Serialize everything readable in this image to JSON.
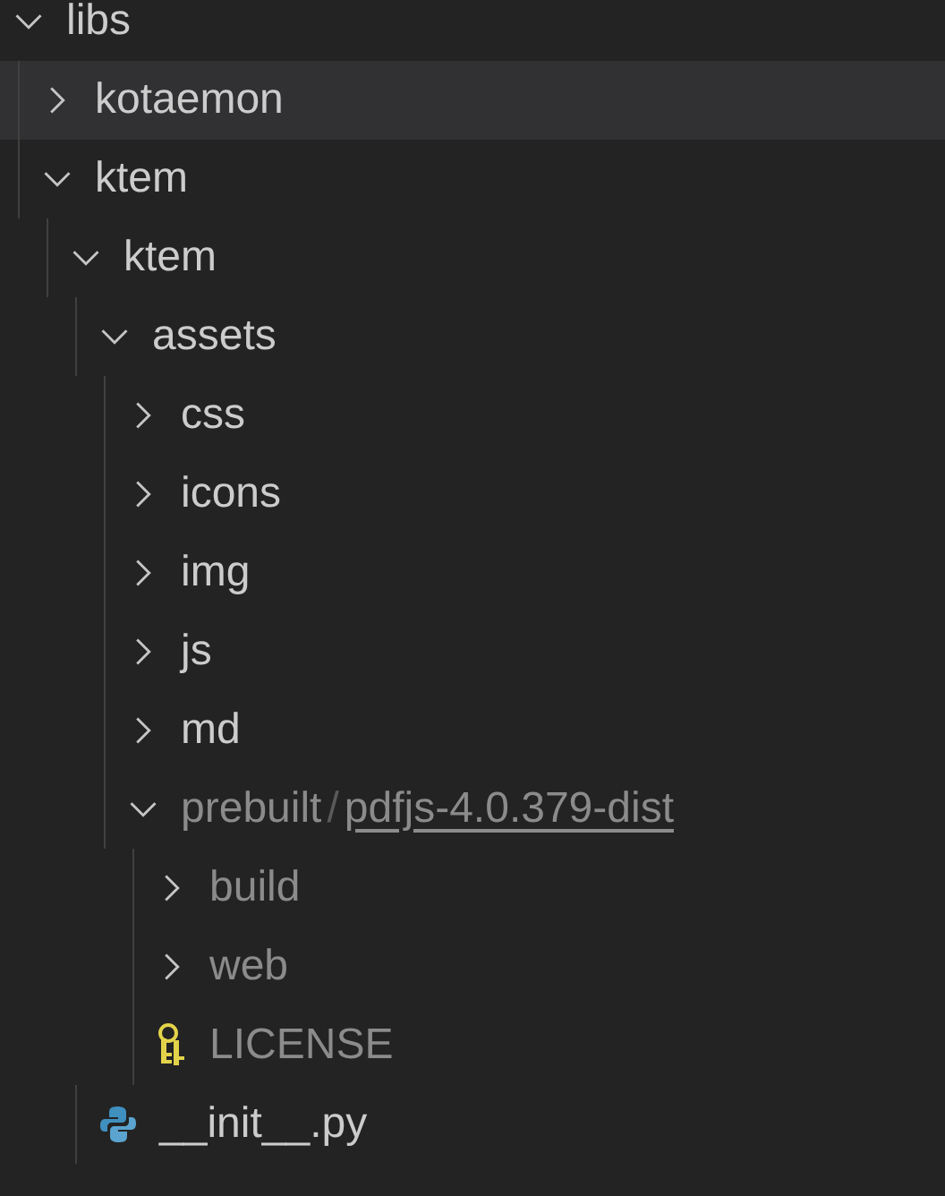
{
  "tree": [
    {
      "kind": "folder",
      "label": "libs",
      "expanded": true,
      "hovered": false,
      "ignored": false,
      "children": [
        {
          "kind": "folder",
          "label": "kotaemon",
          "expanded": false,
          "hovered": true,
          "ignored": false
        },
        {
          "kind": "folder",
          "label": "ktem",
          "expanded": true,
          "hovered": false,
          "ignored": false,
          "children": [
            {
              "kind": "folder",
              "label": "ktem",
              "expanded": true,
              "hovered": false,
              "ignored": false,
              "children": [
                {
                  "kind": "folder",
                  "label": "assets",
                  "expanded": true,
                  "hovered": false,
                  "ignored": false,
                  "children": [
                    {
                      "kind": "folder",
                      "label": "css",
                      "expanded": false,
                      "hovered": false,
                      "ignored": false
                    },
                    {
                      "kind": "folder",
                      "label": "icons",
                      "expanded": false,
                      "hovered": false,
                      "ignored": false
                    },
                    {
                      "kind": "folder",
                      "label": "img",
                      "expanded": false,
                      "hovered": false,
                      "ignored": false
                    },
                    {
                      "kind": "folder",
                      "label": "js",
                      "expanded": false,
                      "hovered": false,
                      "ignored": false
                    },
                    {
                      "kind": "folder",
                      "label": "md",
                      "expanded": false,
                      "hovered": false,
                      "ignored": false
                    },
                    {
                      "kind": "compact-folder",
                      "label": "prebuilt",
                      "separator": "/",
                      "sublabel": "pdfjs-4.0.379-dist",
                      "underlined": true,
                      "expanded": true,
                      "hovered": false,
                      "ignored": true,
                      "children": [
                        {
                          "kind": "folder",
                          "label": "build",
                          "expanded": false,
                          "hovered": false,
                          "ignored": true
                        },
                        {
                          "kind": "folder",
                          "label": "web",
                          "expanded": false,
                          "hovered": false,
                          "ignored": true
                        },
                        {
                          "kind": "license-file",
                          "label": "LICENSE",
                          "hovered": false,
                          "ignored": true
                        }
                      ]
                    }
                  ]
                },
                {
                  "kind": "python-file",
                  "label": "__init__.py",
                  "hovered": false,
                  "ignored": false
                }
              ]
            }
          ]
        }
      ]
    }
  ]
}
